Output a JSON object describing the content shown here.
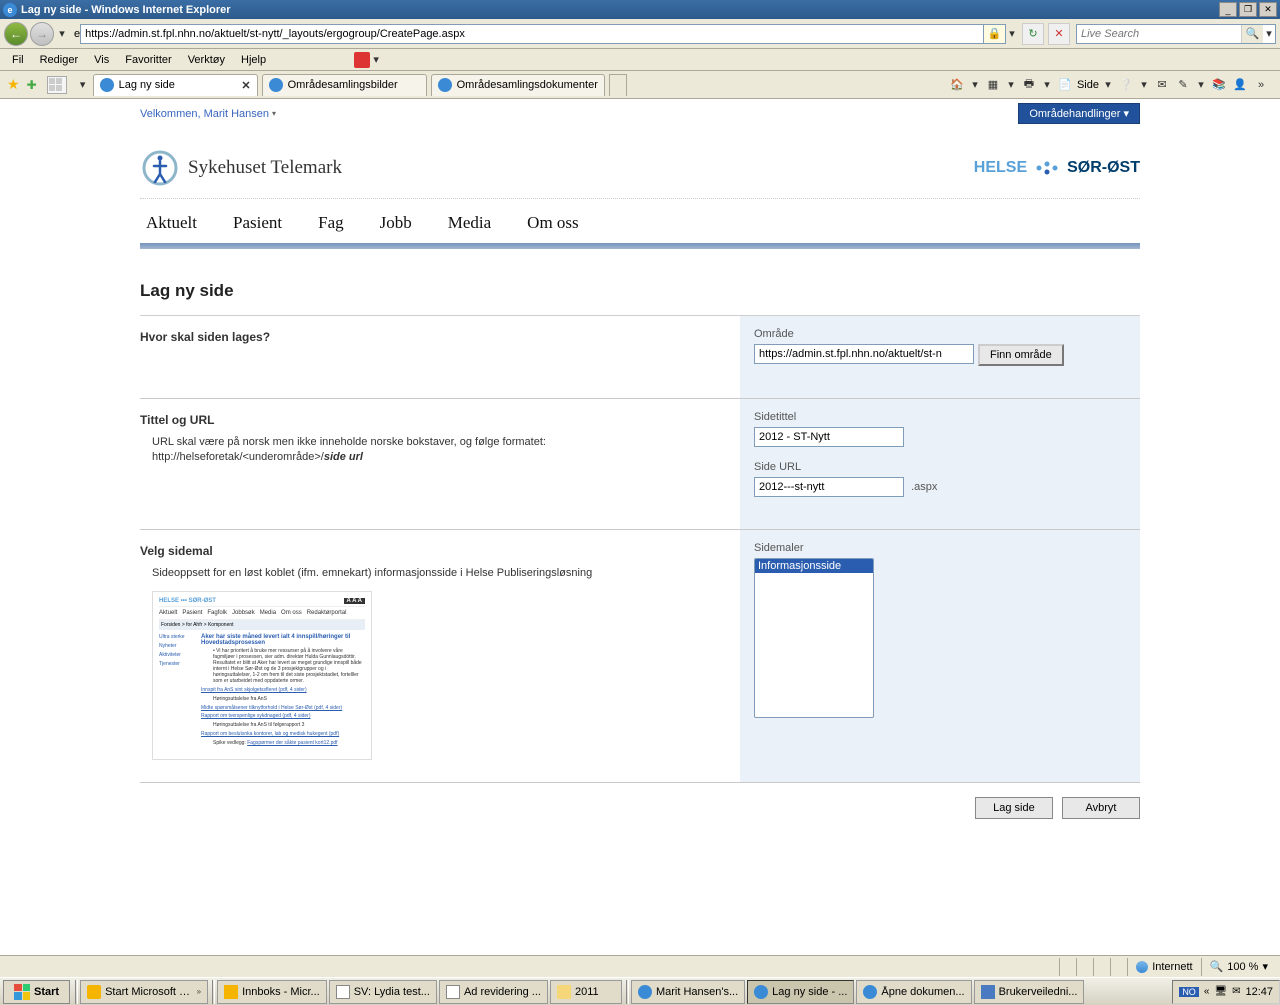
{
  "window": {
    "title": "Lag ny side - Windows Internet Explorer",
    "url": "https://admin.st.fpl.nhn.no/aktuelt/st-nytt/_layouts/ergogroup/CreatePage.aspx",
    "search_placeholder": "Live Search"
  },
  "menu": [
    "Fil",
    "Rediger",
    "Vis",
    "Favoritter",
    "Verktøy",
    "Hjelp"
  ],
  "tabs": [
    {
      "label": "Lag ny side",
      "active": true
    },
    {
      "label": "Områdesamlingsbilder",
      "active": false
    },
    {
      "label": "Områdesamlingsdokumenter",
      "active": false
    }
  ],
  "toolbar_side": "Side",
  "sp": {
    "welcome": "Velkommen, Marit Hansen",
    "actions": "Områdehandlinger ▾"
  },
  "site": {
    "name": "Sykehuset Telemark",
    "brand_left": "HELSE",
    "brand_right": "SØR-ØST"
  },
  "nav": [
    "Aktuelt",
    "Pasient",
    "Fag",
    "Jobb",
    "Media",
    "Om oss"
  ],
  "form": {
    "page_title": "Lag ny side",
    "section1": {
      "heading": "Hvor skal siden lages?",
      "area_label": "Område",
      "area_value": "https://admin.st.fpl.nhn.no/aktuelt/st-n",
      "find_btn": "Finn område"
    },
    "section2": {
      "heading": "Tittel og URL",
      "help1": "URL skal være på norsk men ikke inneholde norske bokstaver, og følge formatet:",
      "help2_prefix": "http://helseforetak/<underområde>/",
      "help2_bold": "side url",
      "title_label": "Sidetittel",
      "title_value": "2012 - ST-Nytt",
      "url_label": "Side URL",
      "url_value": "2012---st-nytt",
      "url_suffix": ".aspx"
    },
    "section3": {
      "heading": "Velg sidemal",
      "desc": "Sideoppsett for en løst koblet (ifm. emnekart) informasjonsside i Helse Publiseringsløsning",
      "templates_label": "Sidemaler",
      "template_option": "Informasjonsside"
    },
    "buttons": {
      "create": "Lag side",
      "cancel": "Avbryt"
    }
  },
  "status": {
    "zone": "Internett",
    "zoom": "100 %"
  },
  "taskbar": {
    "start": "Start",
    "items": [
      "Start Microsoft Office...",
      "Innboks - Micr...",
      "SV: Lydia test...",
      "Ad revidering ...",
      "2011",
      "Marit Hansen's...",
      "Lag ny side - ...",
      "Åpne dokumen...",
      "Brukerveiledni..."
    ],
    "lang": "NO",
    "time": "12:47"
  }
}
